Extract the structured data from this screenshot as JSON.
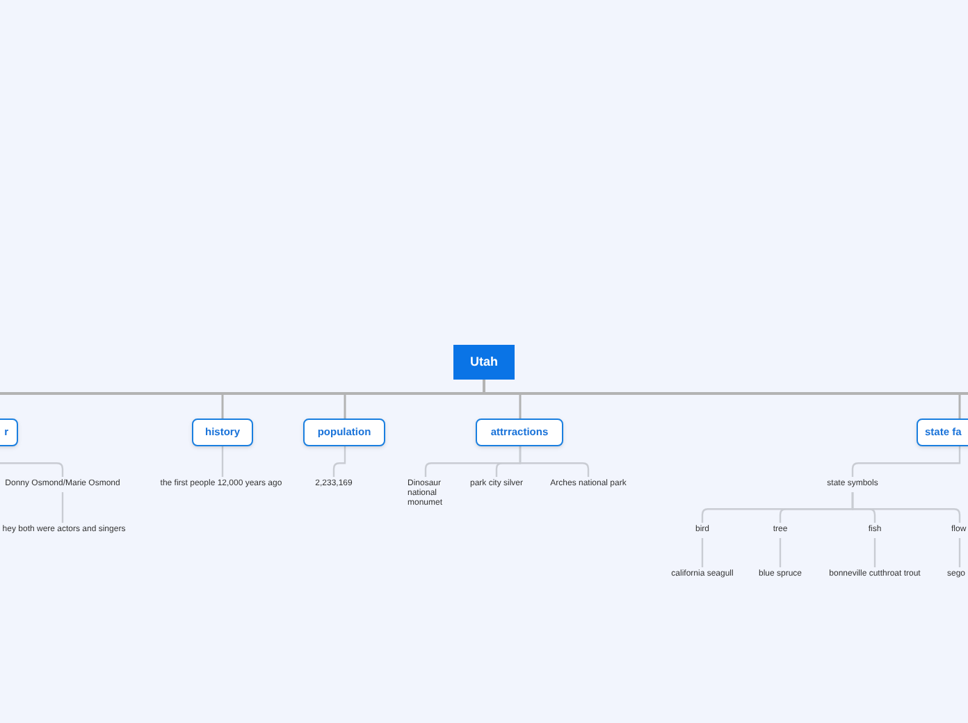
{
  "root": {
    "title": "Utah"
  },
  "topics": [
    {
      "label": "r",
      "children": [
        {
          "text": "Donny Osmond/Marie Osmond",
          "children": [
            {
              "text": "hey both were actors and singers"
            }
          ]
        }
      ]
    },
    {
      "label": "history",
      "children": [
        {
          "text": "the first people 12,000 years ago"
        }
      ]
    },
    {
      "label": "population",
      "children": [
        {
          "text": "2,233,169"
        }
      ]
    },
    {
      "label": "attrractions",
      "children": [
        {
          "text": "Dinosaur national monumet"
        },
        {
          "text": "park city silver"
        },
        {
          "text": "Arches national park"
        }
      ]
    },
    {
      "label": "state fa",
      "children": [
        {
          "text": "state symbols",
          "children": [
            {
              "text": "bird",
              "children": [
                {
                  "text": "california seagull"
                }
              ]
            },
            {
              "text": "tree",
              "children": [
                {
                  "text": "blue spruce"
                }
              ]
            },
            {
              "text": "fish",
              "children": [
                {
                  "text": "bonneville cutthroat trout"
                }
              ]
            },
            {
              "text": "flow",
              "children": [
                {
                  "text": "sego"
                }
              ]
            }
          ]
        }
      ]
    }
  ]
}
